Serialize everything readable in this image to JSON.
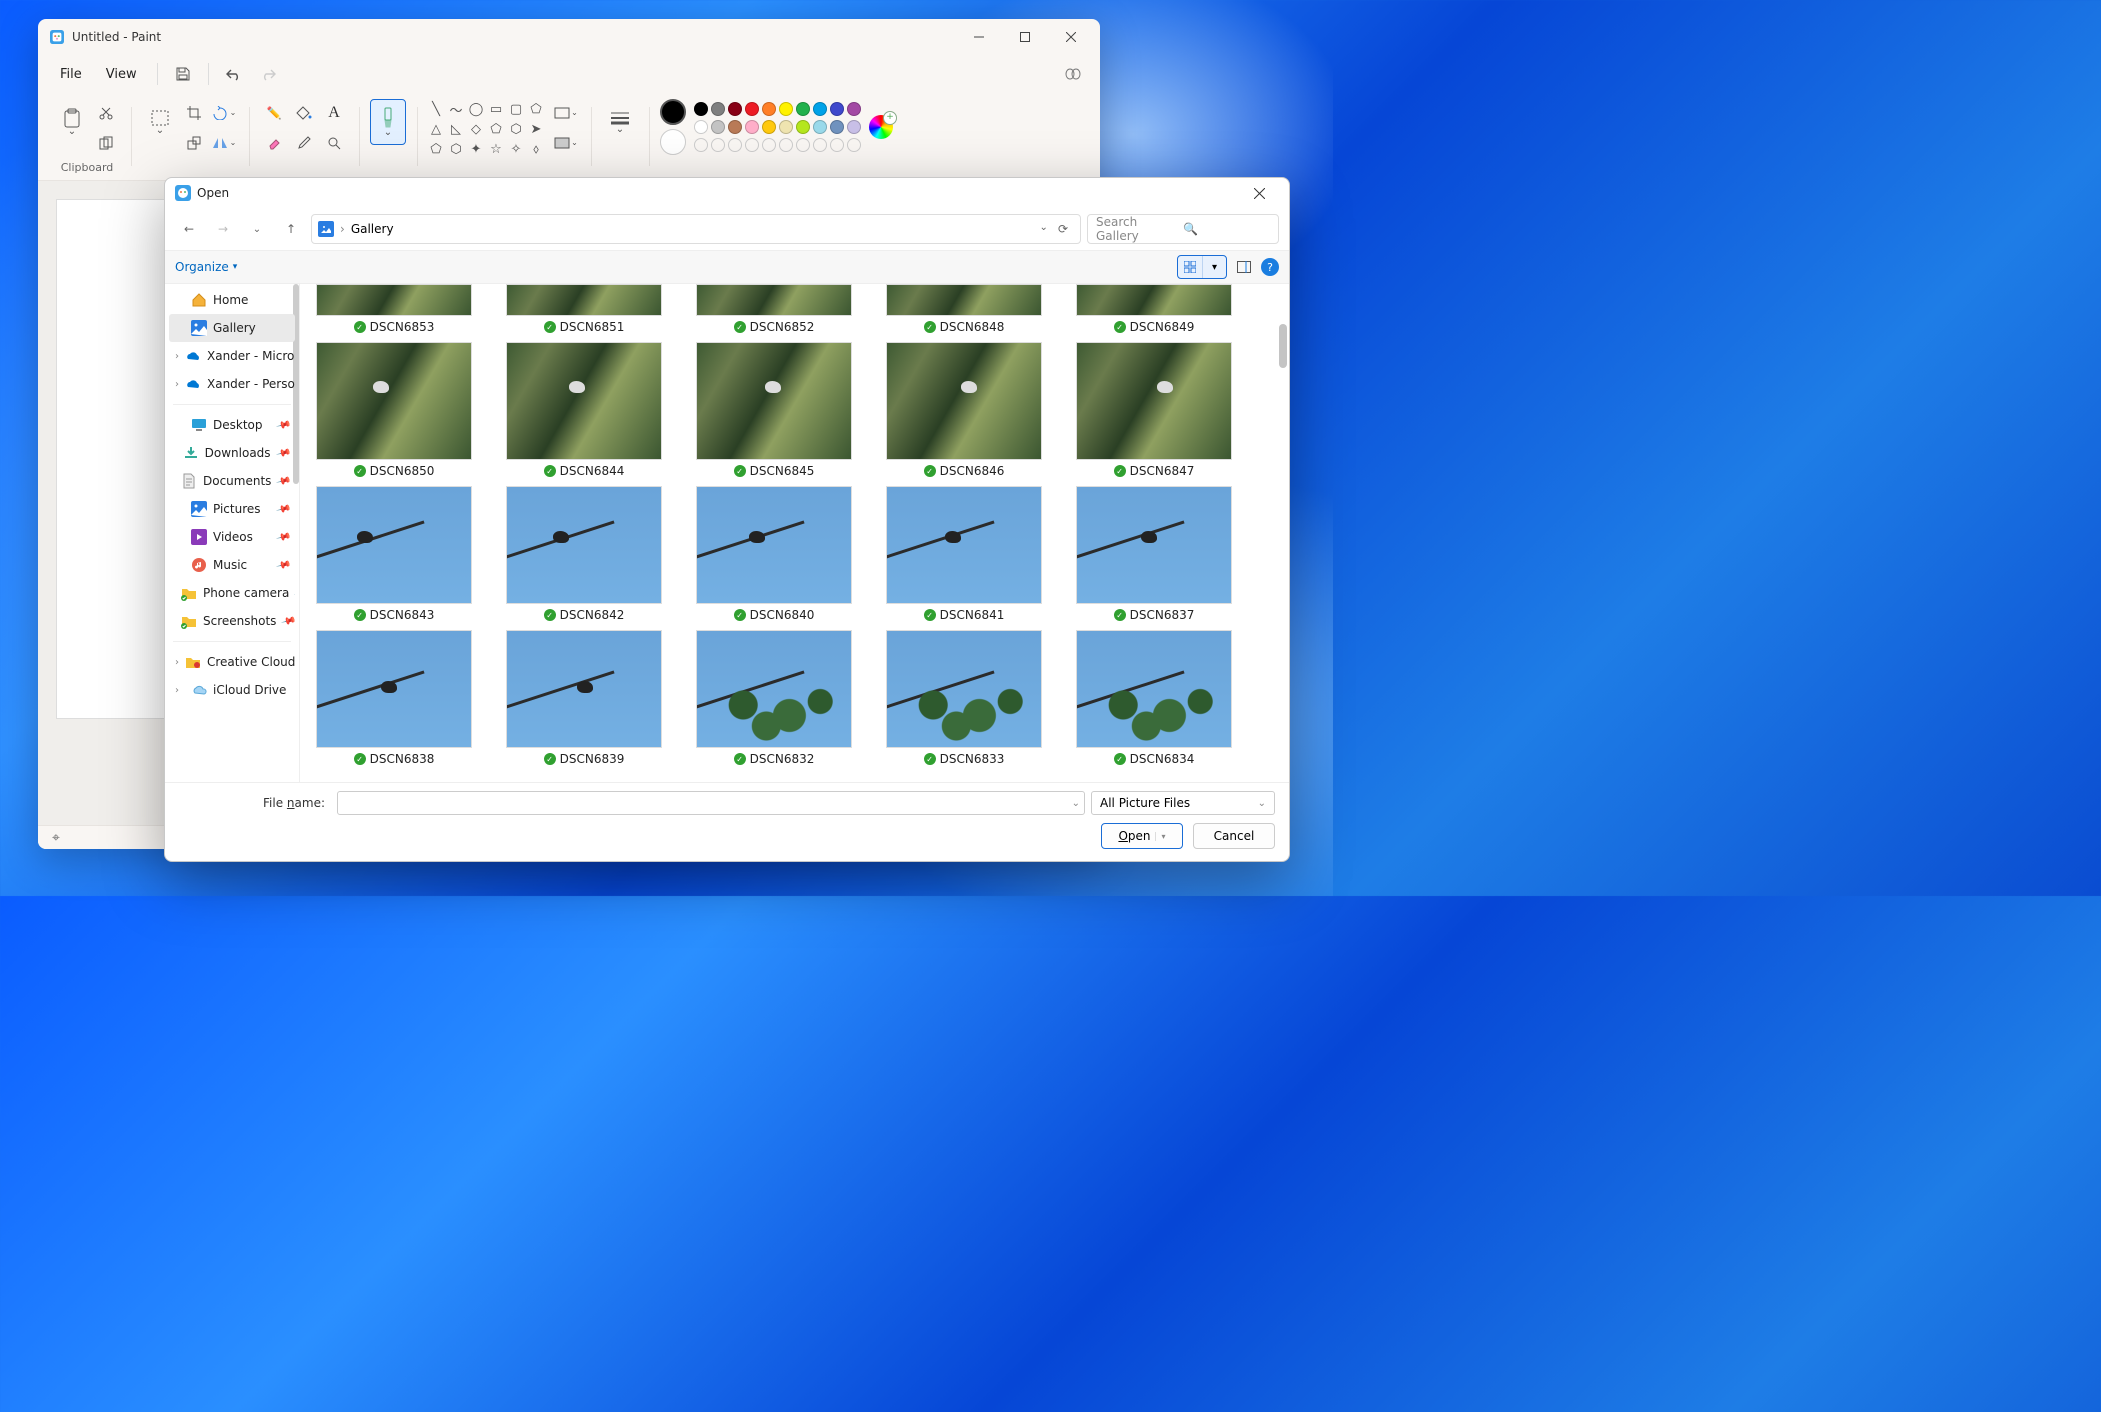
{
  "paint": {
    "title": "Untitled - Paint",
    "menus": {
      "file": "File",
      "view": "View"
    },
    "ribbon": {
      "clipboard_label": "Clipboard"
    }
  },
  "colors_row1": [
    "#000000",
    "#7f7f7f",
    "#880015",
    "#ed1c24",
    "#ff7f27",
    "#fff200",
    "#22b14c",
    "#00a2e8",
    "#3f48cc",
    "#a349a4"
  ],
  "colors_row2": [
    "#ffffff",
    "#c3c3c3",
    "#b97a57",
    "#ffaec9",
    "#ffc90e",
    "#efe4b0",
    "#b5e61d",
    "#99d9ea",
    "#7092be",
    "#c8bfe7"
  ],
  "dialog": {
    "title": "Open",
    "breadcrumb": "Gallery",
    "search_placeholder": "Search Gallery",
    "organize": "Organize",
    "file_name_label": "File name:",
    "file_type": "All Picture Files",
    "open_btn": "Open",
    "cancel_btn": "Cancel"
  },
  "nav": {
    "home": "Home",
    "gallery": "Gallery",
    "od1": "Xander - Microsoft",
    "od2": "Xander - Personal",
    "desktop": "Desktop",
    "downloads": "Downloads",
    "documents": "Documents",
    "pictures": "Pictures",
    "videos": "Videos",
    "music": "Music",
    "phone": "Phone camera",
    "screenshots": "Screenshots",
    "ccf": "Creative Cloud Files",
    "icloud": "iCloud Drive"
  },
  "files": [
    [
      "DSCN6853",
      "DSCN6851",
      "DSCN6852",
      "DSCN6848",
      "DSCN6849"
    ],
    [
      "DSCN6850",
      "DSCN6844",
      "DSCN6845",
      "DSCN6846",
      "DSCN6847"
    ],
    [
      "DSCN6843",
      "DSCN6842",
      "DSCN6840",
      "DSCN6841",
      "DSCN6837"
    ],
    [
      "DSCN6838",
      "DSCN6839",
      "DSCN6832",
      "DSCN6833",
      "DSCN6834"
    ]
  ]
}
